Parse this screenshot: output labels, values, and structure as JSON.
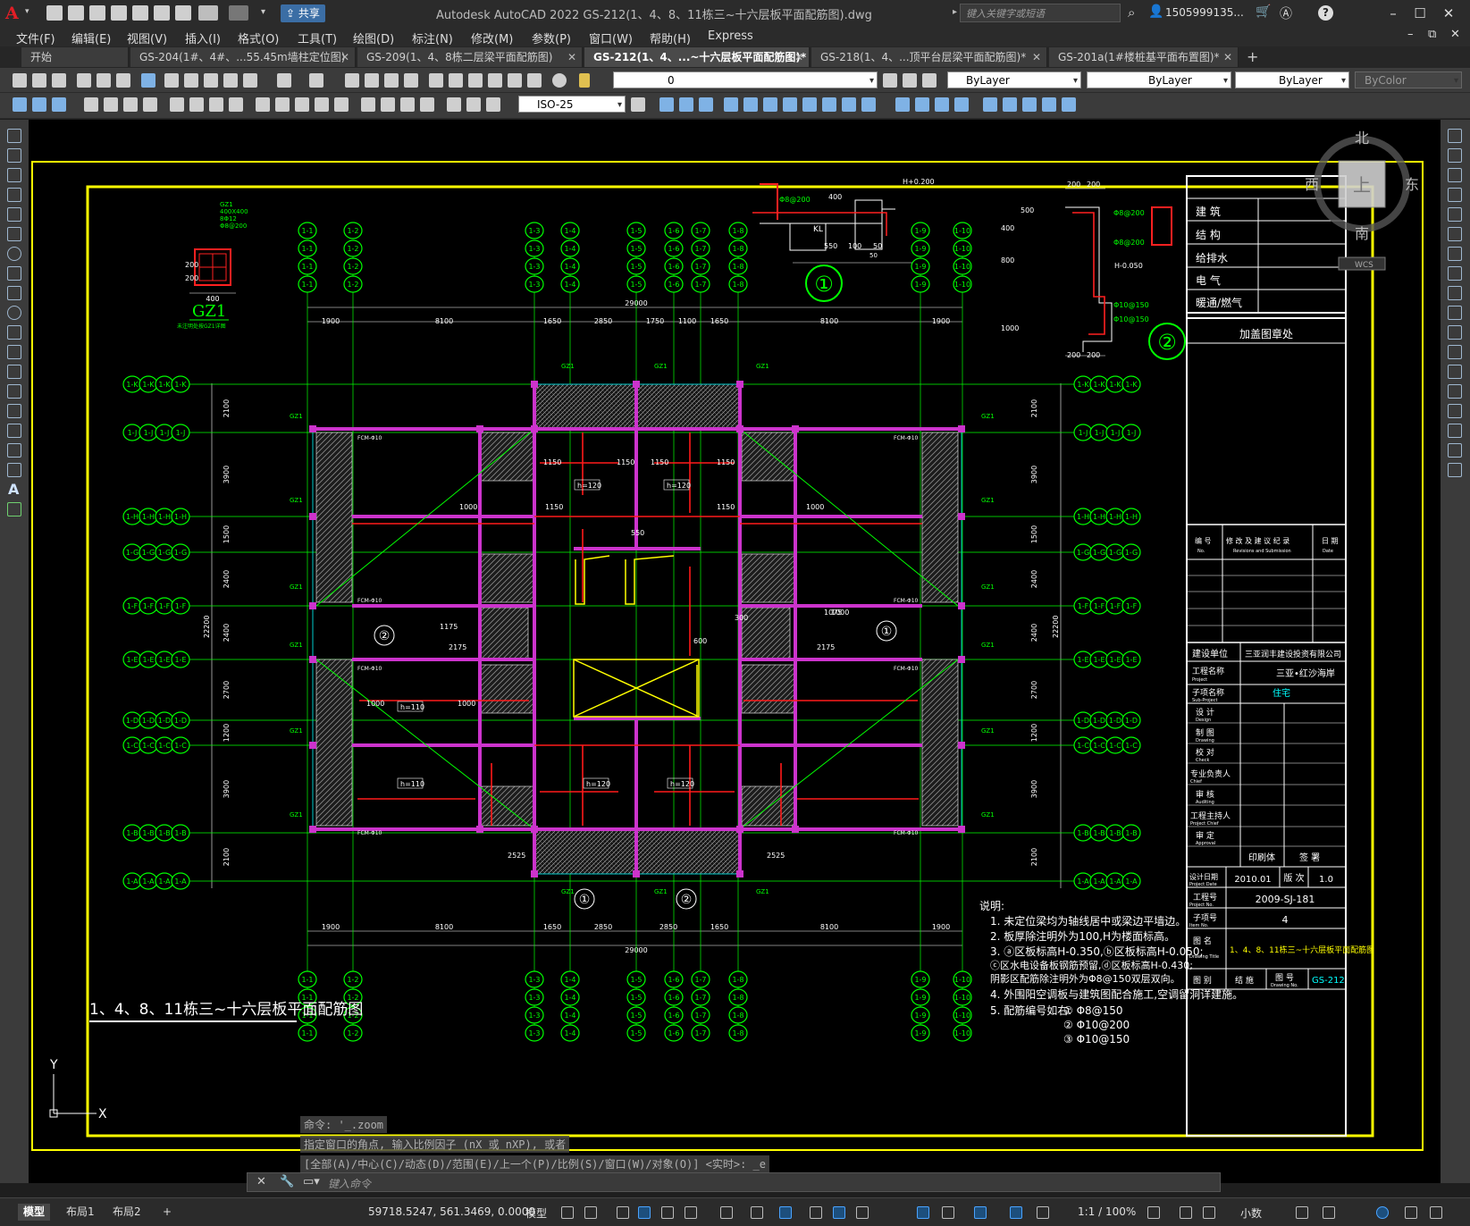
{
  "app": {
    "title": "Autodesk AutoCAD 2022    GS-212(1、4、8、11栋三~十六层板平面配筋图).dwg",
    "share_label": "共享",
    "search_placeholder": "键入关键字或短语",
    "user": "1505999135...",
    "help": "?"
  },
  "menu": [
    "文件(F)",
    "编辑(E)",
    "视图(V)",
    "插入(I)",
    "格式(O)",
    "工具(T)",
    "绘图(D)",
    "标注(N)",
    "修改(M)",
    "参数(P)",
    "窗口(W)",
    "帮助(H)",
    "Express"
  ],
  "tabs": [
    {
      "label": "开始"
    },
    {
      "label": "GS-204(1#、4#、...55.45m墙柱定位图)"
    },
    {
      "label": "GS-209(1、4、8栋二层梁平面配筋图)"
    },
    {
      "label": "GS-212(1、4、...~十六层板平面配筋图)*",
      "active": true
    },
    {
      "label": "GS-218(1、4、...顶平台层梁平面配筋图)*"
    },
    {
      "label": "GS-201a(1#楼桩基平面布置图)*"
    }
  ],
  "properties": {
    "layer": "0",
    "color": "ByLayer",
    "linetype": "ByLayer",
    "lineweight": "ByLayer",
    "plotstyle": "ByColor",
    "dimstyle": "ISO-25"
  },
  "viewcube": {
    "north": "北",
    "south": "南",
    "east": "东",
    "west": "西",
    "top": "上",
    "wcs": "WCS"
  },
  "drawing": {
    "title": "1、4、8、11栋三~十六层板平面配筋图",
    "gz1_label": "GZ1",
    "gz1_specs": [
      "GZ1",
      "400X400",
      "8Φ12",
      "Φ8@200"
    ],
    "gz1_dims": [
      "200",
      "200",
      "400"
    ],
    "gz1_note": "未注明处按GZ1详图",
    "total_width": "29000",
    "total_height": "22200",
    "top_dims": [
      "1900",
      "8100",
      "1650",
      "2850",
      "1750",
      "1100",
      "1650",
      "8100",
      "1900"
    ],
    "bottom_dims": [
      "1900",
      "8100",
      "1650",
      "2850",
      "2850",
      "1650",
      "8100",
      "1900"
    ],
    "side_dims": [
      "2100",
      "3900",
      "1500",
      "2400",
      "2400",
      "2700",
      "1200",
      "3900",
      "2100"
    ],
    "axes_top": [
      "1-1",
      "1-2",
      "1-3",
      "1-4",
      "1-5",
      "1-6",
      "1-7",
      "1-8",
      "1-9",
      "1-10"
    ],
    "axes_side": [
      "1-K",
      "1-J",
      "1-H",
      "1-G",
      "1-F",
      "1-E",
      "1-D",
      "1-C",
      "1-B",
      "1-A"
    ],
    "detail_markers": [
      "①",
      "②"
    ],
    "room_labels": [
      "h=120",
      "h=120",
      "h=110",
      "h=110",
      "h=120",
      "h=120"
    ],
    "rebar_labels": [
      "1150",
      "1150",
      "1150",
      "1150",
      "1000",
      "1000",
      "1000",
      "1000",
      "1150",
      "1150",
      "550",
      "600",
      "2175",
      "2175",
      "2525",
      "2525",
      "1075",
      "1000",
      "1175",
      "300"
    ],
    "fcm_labels": [
      "FCM-Φ10",
      "FCM-Φ10",
      "FCM-Φ10",
      "FCM-Φ10",
      "FCM-Φ10",
      "FCM-Φ10",
      "FCM-Φ10",
      "FCM-Φ10"
    ],
    "gz_tag": "GZ1",
    "notes_title": "说明:",
    "notes": [
      "1. 未定位梁均为轴线居中或梁边平墙边。",
      "2. 板厚除注明外为100,H为楼面标高。",
      "3. ⓐ区板标高H-0.350,ⓑ区板标高H-0.050;",
      "   ⓒ区水电设备板钢筋预留,ⓓ区板标高H-0.430;",
      "   阴影区配筋除注明外为Φ8@150双层双向。",
      "4. 外围阳空调板与建筑图配合施工,空调留洞详建施。",
      "5. 配筋编号如右:"
    ],
    "rebar_codes": [
      "① Φ8@150",
      "② Φ10@200",
      "③ Φ10@150"
    ],
    "det1_labels": [
      "Φ8@200",
      "400",
      "KL",
      "550",
      "100",
      "50",
      "H+0.200",
      "50"
    ],
    "det2_labels": [
      "200",
      "200",
      "500",
      "Φ8@200",
      "Φ8@200",
      "H-0.050",
      "Φ10@150",
      "Φ10@150",
      "200",
      "200",
      "400",
      "800",
      "1000"
    ]
  },
  "title_block": {
    "disciplines": [
      "建 筑",
      "结 构",
      "给排水",
      "电 气",
      "暖通/燃气"
    ],
    "stamp_area": "加盖图章处",
    "revision_header": [
      "编 号",
      "修 改 及 建 议 纪 录",
      "日 期"
    ],
    "revision_sub": [
      "No.",
      "Revisions and Submission",
      "Date"
    ],
    "client_label": "建设单位",
    "client": "三亚润丰建设投资有限公司",
    "project_label": "工程名称",
    "project_en": "Project",
    "project": "三亚•红沙海岸",
    "subproject_label": "子项名称",
    "subproject_en": "Sub-Project",
    "subproject": "住宅",
    "roles": [
      {
        "cn": "设  计",
        "en": "Design"
      },
      {
        "cn": "制  图",
        "en": "Drawing"
      },
      {
        "cn": "校  对",
        "en": "Check"
      },
      {
        "cn": "专业负责人",
        "en": "Chief"
      },
      {
        "cn": "审  核",
        "en": "Auditing"
      },
      {
        "cn": "工程主持人",
        "en": "Project Chief"
      },
      {
        "cn": "审  定",
        "en": "Approval"
      }
    ],
    "print_label": "印刷体",
    "sign_label": "签 署",
    "date_label": "设计日期",
    "date_en": "Project Date",
    "date": "2010.01",
    "version_label": "版 次",
    "version": "1.0",
    "project_no_label": "工程号",
    "project_no_en": "Project No.",
    "project_no": "2009-SJ-181",
    "item_no_label": "子项号",
    "item_no_en": "Item No.",
    "item_no": "4",
    "drawing_title_label": "图 名",
    "drawing_title_en": "Drawing Title",
    "drawing_title": "1、4、8、11栋三~十六层板平面配筋图",
    "category_label": "图 别",
    "category": "结 施",
    "drawing_no_label": "图 号",
    "drawing_no_en": "Drawing No.",
    "drawing_no": "GS-212"
  },
  "command": {
    "history": [
      "命令: '_.zoom",
      "指定窗口的角点, 输入比例因子 (nX 或 nXP), 或者",
      "[全部(A)/中心(C)/动态(D)/范围(E)/上一个(P)/比例(S)/窗口(W)/对象(O)] <实时>: _e"
    ],
    "placeholder": "键入命令"
  },
  "status": {
    "layouts": [
      {
        "label": "模型",
        "active": true
      },
      {
        "label": "布局1"
      },
      {
        "label": "布局2"
      }
    ],
    "add_layout": "+",
    "coords": "59718.5247, 561.3469, 0.0000",
    "space": "模型",
    "scale": "1:1 / 100%",
    "units": "小数"
  },
  "ucs": {
    "x": "X",
    "y": "Y"
  }
}
